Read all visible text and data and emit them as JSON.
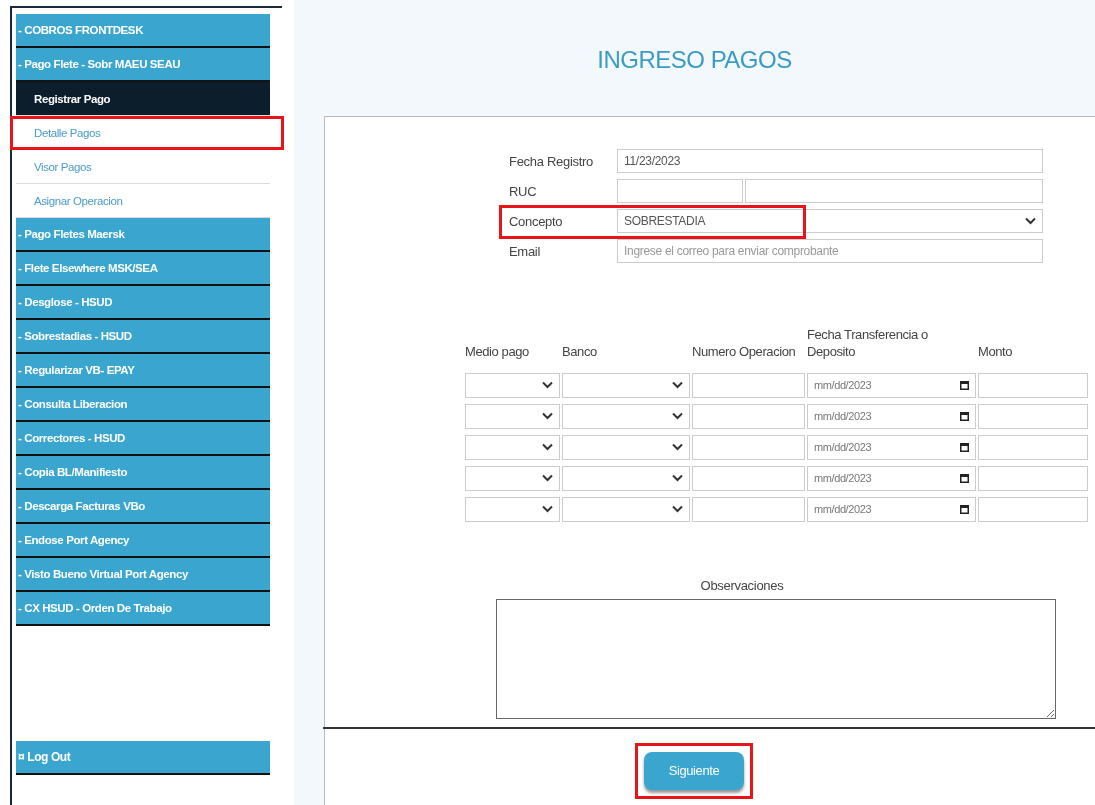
{
  "sidebar": {
    "items": [
      {
        "label": "- COBROS FRONTDESK",
        "kind": "group",
        "selected": false,
        "highlighted": false
      },
      {
        "label": "- Pago Flete - Sobr MAEU SEAU",
        "kind": "group",
        "selected": false,
        "highlighted": false
      },
      {
        "label": "Registrar Pago",
        "kind": "sub",
        "selected": true,
        "highlighted": false
      },
      {
        "label": "Detalle Pagos",
        "kind": "sub",
        "selected": false,
        "highlighted": true
      },
      {
        "label": "Visor Pagos",
        "kind": "sub",
        "selected": false,
        "highlighted": false
      },
      {
        "label": "Asignar Operacion",
        "kind": "sub",
        "selected": false,
        "highlighted": false
      },
      {
        "label": "- Pago Fletes Maersk",
        "kind": "group",
        "selected": false,
        "highlighted": false
      },
      {
        "label": "- Flete Elsewhere MSK/SEA",
        "kind": "group",
        "selected": false,
        "highlighted": false
      },
      {
        "label": "- Desglose - HSUD",
        "kind": "group",
        "selected": false,
        "highlighted": false
      },
      {
        "label": "- Sobrestadias - HSUD",
        "kind": "group",
        "selected": false,
        "highlighted": false
      },
      {
        "label": "- Regularizar VB- EPAY",
        "kind": "group",
        "selected": false,
        "highlighted": false
      },
      {
        "label": "- Consulta Liberacion",
        "kind": "group",
        "selected": false,
        "highlighted": false
      },
      {
        "label": "- Correctores - HSUD",
        "kind": "group",
        "selected": false,
        "highlighted": false
      },
      {
        "label": "- Copia BL/Manifiesto",
        "kind": "group",
        "selected": false,
        "highlighted": false
      },
      {
        "label": "- Descarga Facturas VBo",
        "kind": "group",
        "selected": false,
        "highlighted": false
      },
      {
        "label": "- Endose Port Agency",
        "kind": "group",
        "selected": false,
        "highlighted": false
      },
      {
        "label": "- Visto Bueno Virtual Port Agency",
        "kind": "group",
        "selected": false,
        "highlighted": false
      },
      {
        "label": "- CX HSUD - Orden De Trabajo",
        "kind": "group",
        "selected": false,
        "highlighted": false
      }
    ],
    "logout": "¤ Log Out"
  },
  "page_title": "INGRESO PAGOS",
  "form": {
    "fields": [
      {
        "label": "Fecha Registro",
        "kind": "text",
        "value": "11/23/2023",
        "highlighted": false
      },
      {
        "label": "RUC",
        "kind": "split",
        "highlighted": false
      },
      {
        "label": "Concepto",
        "kind": "select",
        "value": "SOBRESTADIA",
        "highlighted": true
      },
      {
        "label": "Email",
        "kind": "text",
        "placeholder": "Ingrese el correo para enviar comprobante",
        "highlighted": false
      }
    ]
  },
  "payments": {
    "columns": [
      "Medio pago",
      "Banco",
      "Numero Operacion",
      "Fecha Transferencia o Deposito",
      "Monto"
    ],
    "rows": [
      {
        "date_placeholder": "mm/dd/2023"
      },
      {
        "date_placeholder": "mm/dd/2023"
      },
      {
        "date_placeholder": "mm/dd/2023"
      },
      {
        "date_placeholder": "mm/dd/2023"
      },
      {
        "date_placeholder": "mm/dd/2023"
      }
    ]
  },
  "observations": {
    "label": "Observaciones"
  },
  "next_button": {
    "label": "Siguiente",
    "highlighted": true
  }
}
